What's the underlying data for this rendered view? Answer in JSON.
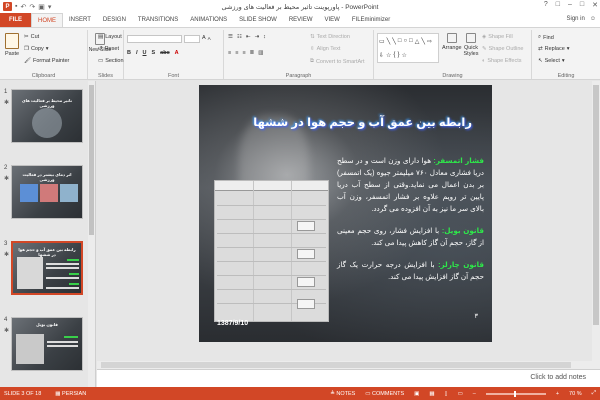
{
  "window": {
    "title": "پاورپوینت تاثیر محیط بر فعالیت های ورزشی - PowerPoint",
    "controls": [
      "?",
      "□",
      "–",
      "□",
      "✕"
    ]
  },
  "tabs": [
    "FILE",
    "HOME",
    "INSERT",
    "DESIGN",
    "TRANSITIONS",
    "ANIMATIONS",
    "SLIDE SHOW",
    "REVIEW",
    "VIEW",
    "FILEminimizer"
  ],
  "active_tab": "HOME",
  "signin": "Sign in",
  "ribbon": {
    "clipboard": {
      "label": "Clipboard",
      "paste": "Paste",
      "cut": "Cut",
      "copy": "Copy",
      "format_painter": "Format Painter"
    },
    "slides": {
      "label": "Slides",
      "new_slide": "New Slide",
      "layout": "Layout",
      "reset": "Reset",
      "section": "Section"
    },
    "font": {
      "label": "Font"
    },
    "paragraph": {
      "label": "Paragraph",
      "text_direction": "Text Direction",
      "align_text": "Align Text",
      "convert_smartart": "Convert to SmartArt"
    },
    "drawing": {
      "label": "Drawing",
      "arrange": "Arrange",
      "quick_styles": "Quick Styles",
      "shape_fill": "Shape Fill",
      "shape_outline": "Shape Outline",
      "shape_effects": "Shape Effects"
    },
    "editing": {
      "label": "Editing",
      "find": "Find",
      "replace": "Replace",
      "select": "Select"
    }
  },
  "thumbnails": [
    {
      "num": "1",
      "title": "تاثیر محیط بر فعالیت های ورزشی"
    },
    {
      "num": "2",
      "title": "اثر دمای بیشتر در فعالیت ورزشی"
    },
    {
      "num": "3",
      "title": "رابطه بین عمق آب و حجم هوا در ششها"
    },
    {
      "num": "4",
      "title": "قانون بویل"
    }
  ],
  "slide": {
    "title": "رابطه بین عمق آب و حجم هوا در ششها",
    "para1_lead": "فشار اتمسفر:",
    "para1_text": " هوا دارای وزن است و در سطح دریا فشاری معادل ۷۶۰ میلیمتر جیوه (یک اتمسفر) بر بدن اعمال می نماید.وقتی از سطح آب دریا پایین تر رویم علاوه بر فشار اتمسفر، وزن آب بالای سر ما نیز به آن افزوده می گردد.",
    "para2_lead": "قانون بویل:",
    "para2_text": " با افزایش فشار، روی حجم معینی از گاز، حجم آن گاز کاهش پیدا می کند.",
    "para3_lead": "قانون چارلز:",
    "para3_text": " با افزایش درجه حرارت یک گاز حجم آن گاز افزایش پیدا می کند.",
    "date": "1387/9/10",
    "page": "۳"
  },
  "notes_placeholder": "Click to add notes",
  "status": {
    "slide_of": "SLIDE 3 OF 18",
    "language": "PERSIAN",
    "notes": "NOTES",
    "comments": "COMMENTS",
    "zoom": "70 %"
  }
}
